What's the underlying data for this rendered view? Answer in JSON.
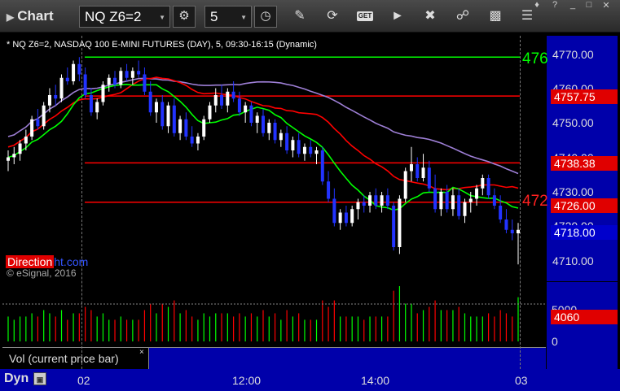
{
  "toolbar": {
    "app_title": "Chart",
    "symbol": "NQ Z6=2",
    "interval": "5",
    "get_label": "GET"
  },
  "chart_desc": "* NQ Z6=2, NASDAQ 100 E-MINI FUTURES (DAY), 5, 09:30-16:15 (Dynamic)",
  "brand": {
    "part1": "Direction",
    "part2": "ht.com"
  },
  "copyright": "© eSignal, 2016",
  "volume_panel": {
    "label": "Vol (current price bar)",
    "close": "×"
  },
  "bottom": {
    "dyn_label": "Dyn"
  },
  "colors": {
    "up_candle": "#ffffff",
    "down_candle": "#2233ff",
    "ma_green": "#00ff00",
    "ma_red": "#ff0000",
    "ma_purple": "#9e7fd6",
    "scale_bg": "#0000aa",
    "tag_red": "#e00000"
  },
  "chart_data": {
    "type": "candlestick",
    "x_ticks": [
      "02",
      "12:00",
      "14:00",
      "03"
    ],
    "y_ticks": [
      "4770.00",
      "4760.00",
      "4750.00",
      "4740.00",
      "4730.00",
      "4720.00",
      "4710.00"
    ],
    "ylim": [
      4706,
      4775
    ],
    "price_tags": [
      {
        "label": "4757.75",
        "value": 4757.75,
        "color": "#e00000"
      },
      {
        "label": "4738.38",
        "value": 4738.38,
        "color": "#e00000"
      },
      {
        "label": "4726.00",
        "value": 4726.0,
        "color": "#e00000"
      },
      {
        "label": "4718.00",
        "value": 4718.0,
        "color": "#0000cc"
      }
    ],
    "horizontal_lines": [
      {
        "value": 4769,
        "color": "#00ff00",
        "label": "476"
      },
      {
        "value": 4757.75,
        "color": "#ff0000",
        "label": ""
      },
      {
        "value": 4738.38,
        "color": "#ff0000",
        "label": ""
      },
      {
        "value": 4727,
        "color": "#ff0000",
        "label": "472"
      }
    ],
    "candles": [
      [
        4739,
        4742,
        4736,
        4740
      ],
      [
        4740,
        4743,
        4738,
        4741
      ],
      [
        4741,
        4745,
        4739,
        4744
      ],
      [
        4744,
        4748,
        4742,
        4746
      ],
      [
        4746,
        4752,
        4745,
        4751
      ],
      [
        4751,
        4754,
        4748,
        4749
      ],
      [
        4749,
        4756,
        4748,
        4755
      ],
      [
        4755,
        4760,
        4753,
        4758
      ],
      [
        4758,
        4761,
        4755,
        4757
      ],
      [
        4757,
        4764,
        4756,
        4763
      ],
      [
        4763,
        4766,
        4761,
        4762
      ],
      [
        4762,
        4768,
        4761,
        4767
      ],
      [
        4767,
        4769,
        4762,
        4764
      ],
      [
        4764,
        4766,
        4757,
        4758
      ],
      [
        4758,
        4760,
        4752,
        4753
      ],
      [
        4753,
        4757,
        4751,
        4756
      ],
      [
        4756,
        4762,
        4755,
        4761
      ],
      [
        4761,
        4764,
        4759,
        4763
      ],
      [
        4763,
        4765,
        4760,
        4761
      ],
      [
        4761,
        4766,
        4760,
        4765
      ],
      [
        4765,
        4767,
        4762,
        4763
      ],
      [
        4763,
        4766,
        4761,
        4765
      ],
      [
        4765,
        4768,
        4763,
        4764
      ],
      [
        4764,
        4766,
        4758,
        4759
      ],
      [
        4759,
        4762,
        4752,
        4753
      ],
      [
        4753,
        4757,
        4750,
        4756
      ],
      [
        4756,
        4758,
        4748,
        4749
      ],
      [
        4749,
        4756,
        4747,
        4755
      ],
      [
        4755,
        4757,
        4746,
        4747
      ],
      [
        4747,
        4752,
        4745,
        4751
      ],
      [
        4751,
        4753,
        4745,
        4746
      ],
      [
        4746,
        4749,
        4743,
        4744
      ],
      [
        4744,
        4747,
        4742,
        4746
      ],
      [
        4746,
        4752,
        4745,
        4751
      ],
      [
        4751,
        4756,
        4750,
        4755
      ],
      [
        4755,
        4760,
        4753,
        4758
      ],
      [
        4758,
        4761,
        4754,
        4755
      ],
      [
        4755,
        4760,
        4753,
        4759
      ],
      [
        4759,
        4762,
        4756,
        4757
      ],
      [
        4757,
        4759,
        4752,
        4753
      ],
      [
        4753,
        4756,
        4750,
        4755
      ],
      [
        4755,
        4756,
        4749,
        4750
      ],
      [
        4750,
        4753,
        4747,
        4752
      ],
      [
        4752,
        4754,
        4746,
        4747
      ],
      [
        4747,
        4751,
        4745,
        4750
      ],
      [
        4750,
        4751,
        4744,
        4745
      ],
      [
        4745,
        4748,
        4743,
        4747
      ],
      [
        4747,
        4749,
        4741,
        4742
      ],
      [
        4742,
        4746,
        4740,
        4745
      ],
      [
        4745,
        4747,
        4740,
        4741
      ],
      [
        4741,
        4744,
        4739,
        4743
      ],
      [
        4743,
        4745,
        4740,
        4741
      ],
      [
        4741,
        4743,
        4738,
        4742
      ],
      [
        4742,
        4743,
        4732,
        4733
      ],
      [
        4733,
        4736,
        4727,
        4728
      ],
      [
        4728,
        4731,
        4720,
        4721
      ],
      [
        4721,
        4725,
        4719,
        4724
      ],
      [
        4724,
        4726,
        4720,
        4721
      ],
      [
        4721,
        4726,
        4720,
        4725
      ],
      [
        4725,
        4728,
        4722,
        4727
      ],
      [
        4727,
        4729,
        4724,
        4726
      ],
      [
        4726,
        4730,
        4724,
        4729
      ],
      [
        4729,
        4731,
        4725,
        4726
      ],
      [
        4726,
        4730,
        4724,
        4729
      ],
      [
        4729,
        4731,
        4725,
        4726
      ],
      [
        4726,
        4727,
        4713,
        4714
      ],
      [
        4714,
        4729,
        4712,
        4728
      ],
      [
        4728,
        4737,
        4727,
        4736
      ],
      [
        4736,
        4743,
        4733,
        4738
      ],
      [
        4738,
        4740,
        4733,
        4734
      ],
      [
        4734,
        4741,
        4733,
        4737
      ],
      [
        4737,
        4739,
        4730,
        4731
      ],
      [
        4731,
        4735,
        4724,
        4725
      ],
      [
        4725,
        4731,
        4723,
        4730
      ],
      [
        4730,
        4732,
        4724,
        4725
      ],
      [
        4725,
        4731,
        4723,
        4729
      ],
      [
        4729,
        4731,
        4722,
        4723
      ],
      [
        4723,
        4728,
        4721,
        4727
      ],
      [
        4727,
        4730,
        4724,
        4728
      ],
      [
        4728,
        4732,
        4726,
        4731
      ],
      [
        4731,
        4735,
        4729,
        4734
      ],
      [
        4734,
        4735,
        4728,
        4729
      ],
      [
        4729,
        4731,
        4725,
        4726
      ],
      [
        4726,
        4729,
        4721,
        4722
      ],
      [
        4722,
        4725,
        4718,
        4719
      ],
      [
        4719,
        4722,
        4716,
        4718
      ],
      [
        4718,
        4721,
        4709,
        4719
      ]
    ],
    "volume_ylim": [
      0,
      6000
    ],
    "volume_ticks": [
      "5000",
      "0"
    ],
    "volume_tag": {
      "label": "4060",
      "value": 4060
    }
  }
}
